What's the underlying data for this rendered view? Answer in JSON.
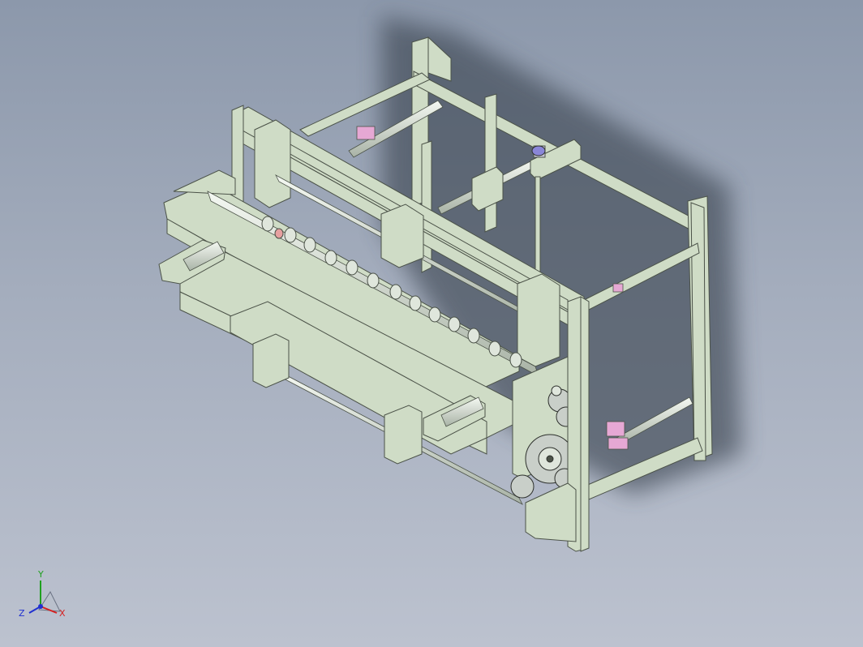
{
  "viewport": {
    "colors": {
      "background_top": "#8c98ab",
      "background_bottom": "#bcc2cf",
      "frame": "#cfdcc6",
      "frame_edge": "#4b5248",
      "shaft": "#dfe6dc",
      "pink_block": "#e6a8d4",
      "gear": "#c9cfc9",
      "shadow": "#3e4652"
    }
  },
  "triad": {
    "x_label": "X",
    "y_label": "Y",
    "z_label": "Z",
    "x_color": "#d62020",
    "y_color": "#20a020",
    "z_color": "#2030d0"
  }
}
